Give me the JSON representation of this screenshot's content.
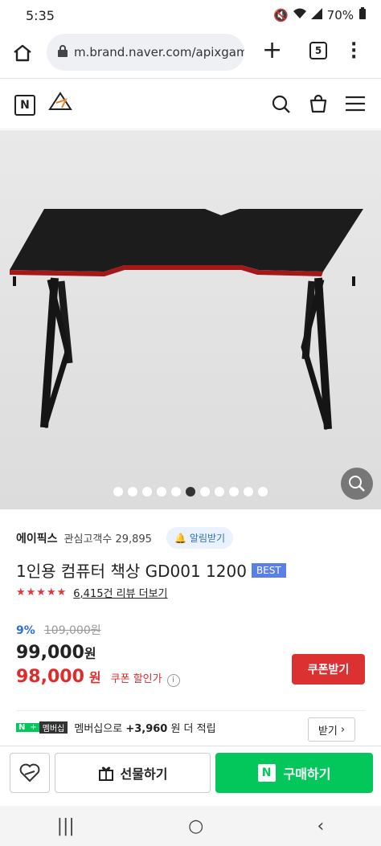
{
  "status": {
    "time": "5:35",
    "battery": "70%"
  },
  "browser": {
    "url": "m.brand.naver.com/apixgami",
    "tab_count": "5"
  },
  "header": {
    "brand_logo_text": "APIX"
  },
  "gallery": {
    "total_images": 11,
    "active_index": 5
  },
  "store": {
    "name": "에이픽스",
    "interest_label": "관심고객수 29,895",
    "alarm_label": "알림받기"
  },
  "product": {
    "title": "1인용 컴퓨터 책상 GD001 1200",
    "badge": "BEST",
    "rating_stars": 5,
    "review_text": "6,415건 리뷰 더보기",
    "discount_rate": "9%",
    "original_price": "109,000원",
    "sale_price": "99,000",
    "sale_unit": "원",
    "coupon_price": "98,000",
    "coupon_unit": "원",
    "coupon_label": "쿠폰 할인가",
    "coupon_button": "쿠폰받기"
  },
  "membership": {
    "badge_n": "N",
    "badge_plus": "+",
    "badge_text": "멤버십",
    "text_prefix": "멤버십으로 ",
    "points": "+3,960",
    "text_suffix": " 원 더 적립",
    "button": "받기"
  },
  "bottom": {
    "gift_label": "선물하기",
    "buy_label": "구매하기",
    "buy_icon": "N"
  },
  "colors": {
    "naver_green": "#03c75a",
    "coupon_red": "#dc3131",
    "accent_blue": "#2f6ed8"
  }
}
